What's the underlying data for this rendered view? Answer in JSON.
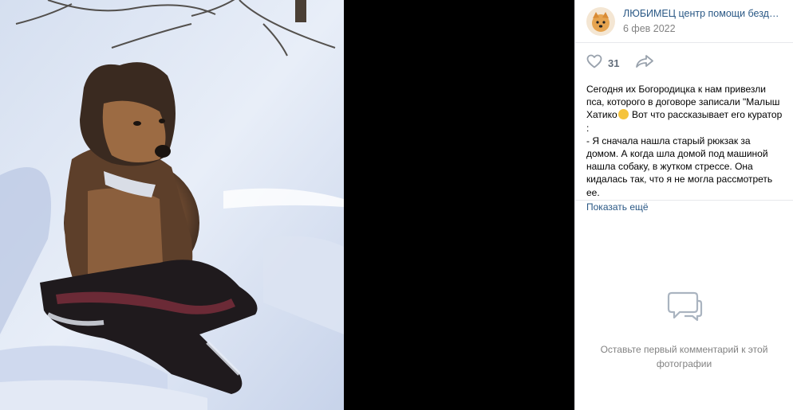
{
  "author": {
    "name": "ЛЮБИМЕЦ центр помощи бездомным",
    "date": "6 фев 2022"
  },
  "actions": {
    "like_count": "31"
  },
  "post": {
    "text_1": "Сегодня их Богородицка к нам привезли пса, которого в договоре записали \"Малыш Хатико",
    "text_2": " Вот что рассказывает его куратор :\n- Я сначала нашла старый рюкзак за домом. А когда шла домой под машиной нашла собаку, в жутком стрессе. Она кидалась так, что я не могла рассмотреть ее.",
    "show_more": "Показать ещё"
  },
  "comments": {
    "empty_text": "Оставьте первый комментарий к этой фотографии"
  },
  "icons": {
    "like": "heart-icon",
    "share": "share-arrow-icon",
    "comments": "comment-bubbles-icon"
  },
  "colors": {
    "link": "#2a5885",
    "muted": "#828282",
    "icon": "#99a2ad"
  }
}
